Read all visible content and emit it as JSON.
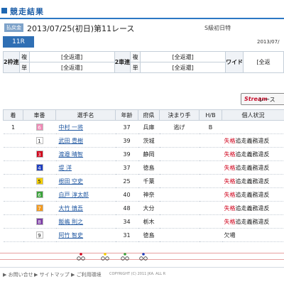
{
  "header": {
    "title": "競走結果"
  },
  "race": {
    "venue_badge": "払戻金",
    "title": "2013/07/25(初日)第11レース",
    "grade": "S級初日特",
    "race_no": "11R",
    "date_right": "2013/07/"
  },
  "bets": {
    "bracket": {
      "label": "2枠連",
      "rows": [
        {
          "type": "複",
          "value": "[全返還]"
        },
        {
          "type": "単",
          "value": "[全返還]"
        }
      ]
    },
    "quinella": {
      "label": "2車連",
      "rows": [
        {
          "type": "複",
          "value": "[全返還]"
        },
        {
          "type": "単",
          "value": "[全返還]"
        }
      ]
    },
    "wide": {
      "label": "ワイド",
      "value": "[全返"
    }
  },
  "ticket_button": {
    "logo": "Stream",
    "label": "レース"
  },
  "table": {
    "headers": [
      "着",
      "車番",
      "選手名",
      "年齢",
      "府県",
      "決まり手",
      "H/B",
      "個人状況"
    ],
    "rows": [
      {
        "rank": "1",
        "num": "6",
        "name": "中村 一将",
        "age": "37",
        "pref": "兵庫",
        "kimarite": "逃げ",
        "hb": "B",
        "status": "",
        "status2": "",
        "color": "#f08ab6",
        "text_color": "#fff"
      },
      {
        "rank": "",
        "num": "1",
        "name": "武田 豊樹",
        "age": "39",
        "pref": "茨城",
        "kimarite": "",
        "hb": "",
        "status": "失格",
        "status2": "追走義務違反",
        "color": "#ffffff",
        "text_color": "#222"
      },
      {
        "rank": "",
        "num": "3",
        "name": "渡邉 晴智",
        "age": "39",
        "pref": "静岡",
        "kimarite": "",
        "hb": "",
        "status": "失格",
        "status2": "追走義務違反",
        "color": "#d0021b",
        "text_color": "#fff"
      },
      {
        "rank": "",
        "num": "4",
        "name": "堤 洋",
        "age": "37",
        "pref": "徳島",
        "kimarite": "",
        "hb": "",
        "status": "失格",
        "status2": "追走義務違反",
        "color": "#1f3fbf",
        "text_color": "#fff"
      },
      {
        "rank": "",
        "num": "5",
        "name": "根田 空史",
        "age": "25",
        "pref": "千葉",
        "kimarite": "",
        "hb": "",
        "status": "失格",
        "status2": "追走義務違反",
        "color": "#f5d000",
        "text_color": "#222"
      },
      {
        "rank": "",
        "num": "6",
        "name": "白戸 淳太郎",
        "age": "40",
        "pref": "神奈",
        "kimarite": "",
        "hb": "",
        "status": "失格",
        "status2": "追走義務違反",
        "color": "#3aa23a",
        "text_color": "#fff"
      },
      {
        "rank": "",
        "num": "7",
        "name": "大竹 慎吾",
        "age": "48",
        "pref": "大分",
        "kimarite": "",
        "hb": "",
        "status": "失格",
        "status2": "追走義務違反",
        "color": "#f39a1f",
        "text_color": "#fff"
      },
      {
        "rank": "",
        "num": "8",
        "name": "飯嶋 則之",
        "age": "34",
        "pref": "栃木",
        "kimarite": "",
        "hb": "",
        "status": "失格",
        "status2": "追走義務違反",
        "color": "#7e3fa6",
        "text_color": "#fff"
      },
      {
        "rank": "",
        "num": "9",
        "name": "阿竹 智史",
        "age": "31",
        "pref": "徳島",
        "kimarite": "",
        "hb": "",
        "status": "欠場",
        "status2": "",
        "color": "#ffffff",
        "text_color": "#222"
      }
    ]
  },
  "footer": {
    "links": [
      "お問い合せ",
      "サイトマップ",
      "ご利用環境"
    ],
    "copyright": "COPYRIGHT (C) 2011 JKA. ALL R"
  },
  "colors": {
    "accent": "#2c78c4",
    "header_text": "#1d5ea8",
    "error": "#d0021b",
    "link": "#1e56a0"
  }
}
